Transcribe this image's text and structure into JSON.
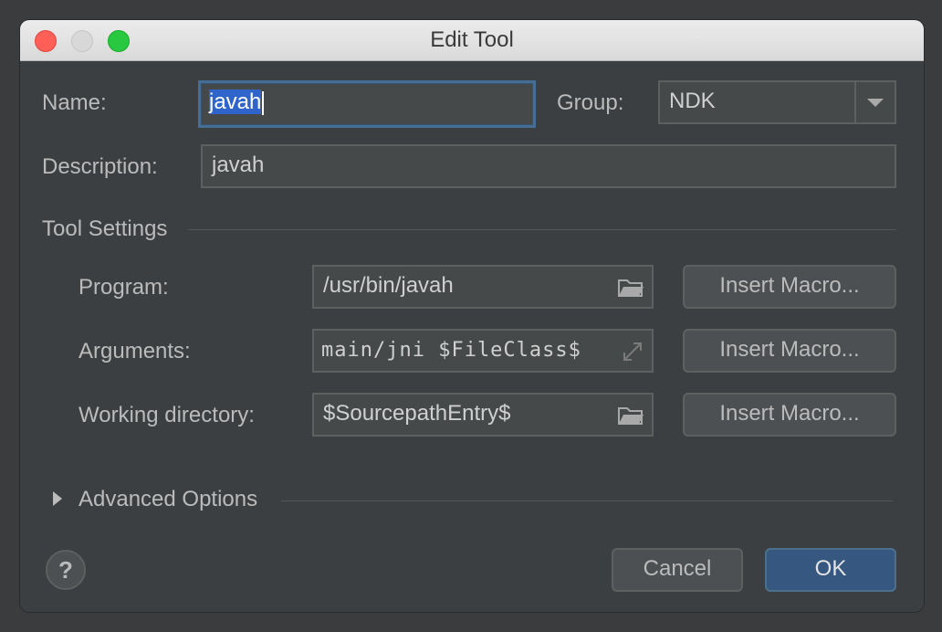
{
  "window": {
    "title": "Edit Tool"
  },
  "form": {
    "name_label": "Name:",
    "name_value": "javah",
    "group_label": "Group:",
    "group_value": "NDK",
    "description_label": "Description:",
    "description_value": "javah"
  },
  "tool_settings": {
    "section_label": "Tool Settings",
    "program_label": "Program:",
    "program_value": "/usr/bin/javah",
    "arguments_label": "Arguments:",
    "arguments_value": "main/jni $FileClass$",
    "working_dir_label": "Working directory:",
    "working_dir_value": "$SourcepathEntry$",
    "insert_macro_label": "Insert Macro..."
  },
  "advanced": {
    "label": "Advanced Options"
  },
  "footer": {
    "help_label": "?",
    "cancel_label": "Cancel",
    "ok_label": "OK"
  },
  "icons": {
    "browse": "folder-icon",
    "expand": "expand-arrows-icon",
    "dropdown": "chevron-down-icon",
    "disclosure": "disclosure-triangle-icon"
  },
  "colors": {
    "background": "#3c3f41",
    "focus_border": "#466d94",
    "selection": "#2f65ca",
    "default_button": "#365880",
    "close": "#fe5f57",
    "maximize": "#28c840"
  }
}
